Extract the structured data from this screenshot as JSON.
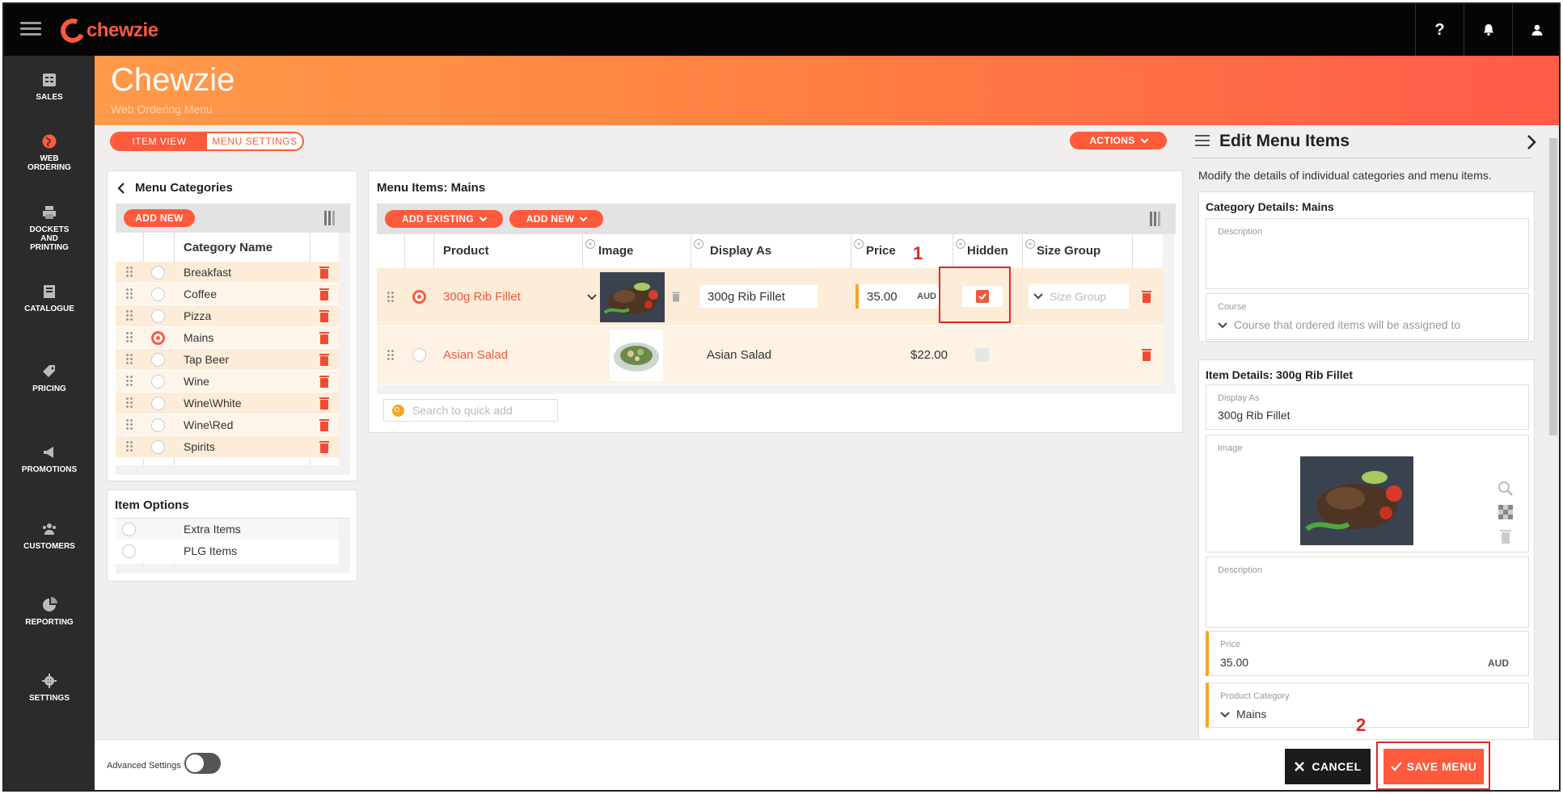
{
  "app": {
    "logo_text": "chewzie"
  },
  "topbar": {
    "help": "?",
    "bell_icon": "bell-icon",
    "user_icon": "user-icon"
  },
  "sidebar": {
    "items": [
      {
        "label": "SALES",
        "icon": "sales-icon"
      },
      {
        "label": "WEB ORDERING",
        "icon": "globe-icon"
      },
      {
        "label": "DOCKETS AND PRINTING",
        "icon": "printer-icon"
      },
      {
        "label": "CATALOGUE",
        "icon": "catalogue-icon"
      },
      {
        "label": "PRICING",
        "icon": "tag-icon"
      },
      {
        "label": "PROMOTIONS",
        "icon": "megaphone-icon"
      },
      {
        "label": "CUSTOMERS",
        "icon": "users-icon"
      },
      {
        "label": "REPORTING",
        "icon": "pie-chart-icon"
      },
      {
        "label": "SETTINGS",
        "icon": "gear-icon"
      }
    ]
  },
  "header": {
    "title": "Chewzie",
    "subtitle": "Web Ordering Menu"
  },
  "view_tabs": {
    "item_view": "ITEM VIEW",
    "menu_settings": "MENU SETTINGS"
  },
  "actions": {
    "label": "ACTIONS"
  },
  "categories": {
    "title": "Menu Categories",
    "add_new": "ADD NEW",
    "column": "Category Name",
    "rows": [
      "Breakfast",
      "Coffee",
      "Pizza",
      "Mains",
      "Tap Beer",
      "Wine",
      "Wine\\White",
      "Wine\\Red",
      "Spirits"
    ],
    "selected_index": 3
  },
  "item_options": {
    "title": "Item Options",
    "rows": [
      "Extra Items",
      "PLG Items"
    ]
  },
  "menu_items": {
    "title": "Menu Items: Mains",
    "add_existing": "ADD EXISTING",
    "add_new": "ADD NEW",
    "columns": {
      "product": "Product",
      "image": "Image",
      "display_as": "Display As",
      "price": "Price",
      "hidden": "Hidden",
      "size_group": "Size Group"
    },
    "rows": [
      {
        "product": "300g Rib Fillet",
        "display_as": "300g Rib Fillet",
        "price": "35.00",
        "currency": "AUD",
        "hidden": true,
        "size_group_placeholder": "Size Group"
      },
      {
        "product": "Asian Salad",
        "display_as": "Asian Salad",
        "price": "$22.00",
        "hidden": false
      }
    ],
    "search_placeholder": "Search to quick add"
  },
  "edit_panel": {
    "title": "Edit Menu Items",
    "description": "Modify the details of individual categories and menu items.",
    "category_section": "Category Details: Mains",
    "description_label": "Description",
    "course_label": "Course",
    "course_placeholder": "Course that ordered items will be assigned to",
    "item_section": "Item Details: 300g Rib Fillet",
    "display_as_label": "Display As",
    "display_as_value": "300g Rib Fillet",
    "image_label": "Image",
    "item_description_label": "Description",
    "price_label": "Price",
    "price_value": "35.00",
    "currency": "AUD",
    "product_category_label": "Product Category",
    "product_category_value": "Mains"
  },
  "footer": {
    "advanced_settings": "Advanced Settings",
    "cancel": "CANCEL",
    "save": "SAVE MENU"
  },
  "annotations": {
    "one": "1",
    "two": "2"
  },
  "colors": {
    "accent": "#ff5a3c",
    "sidebar": "#2b2b2b",
    "topbar": "#050505"
  }
}
